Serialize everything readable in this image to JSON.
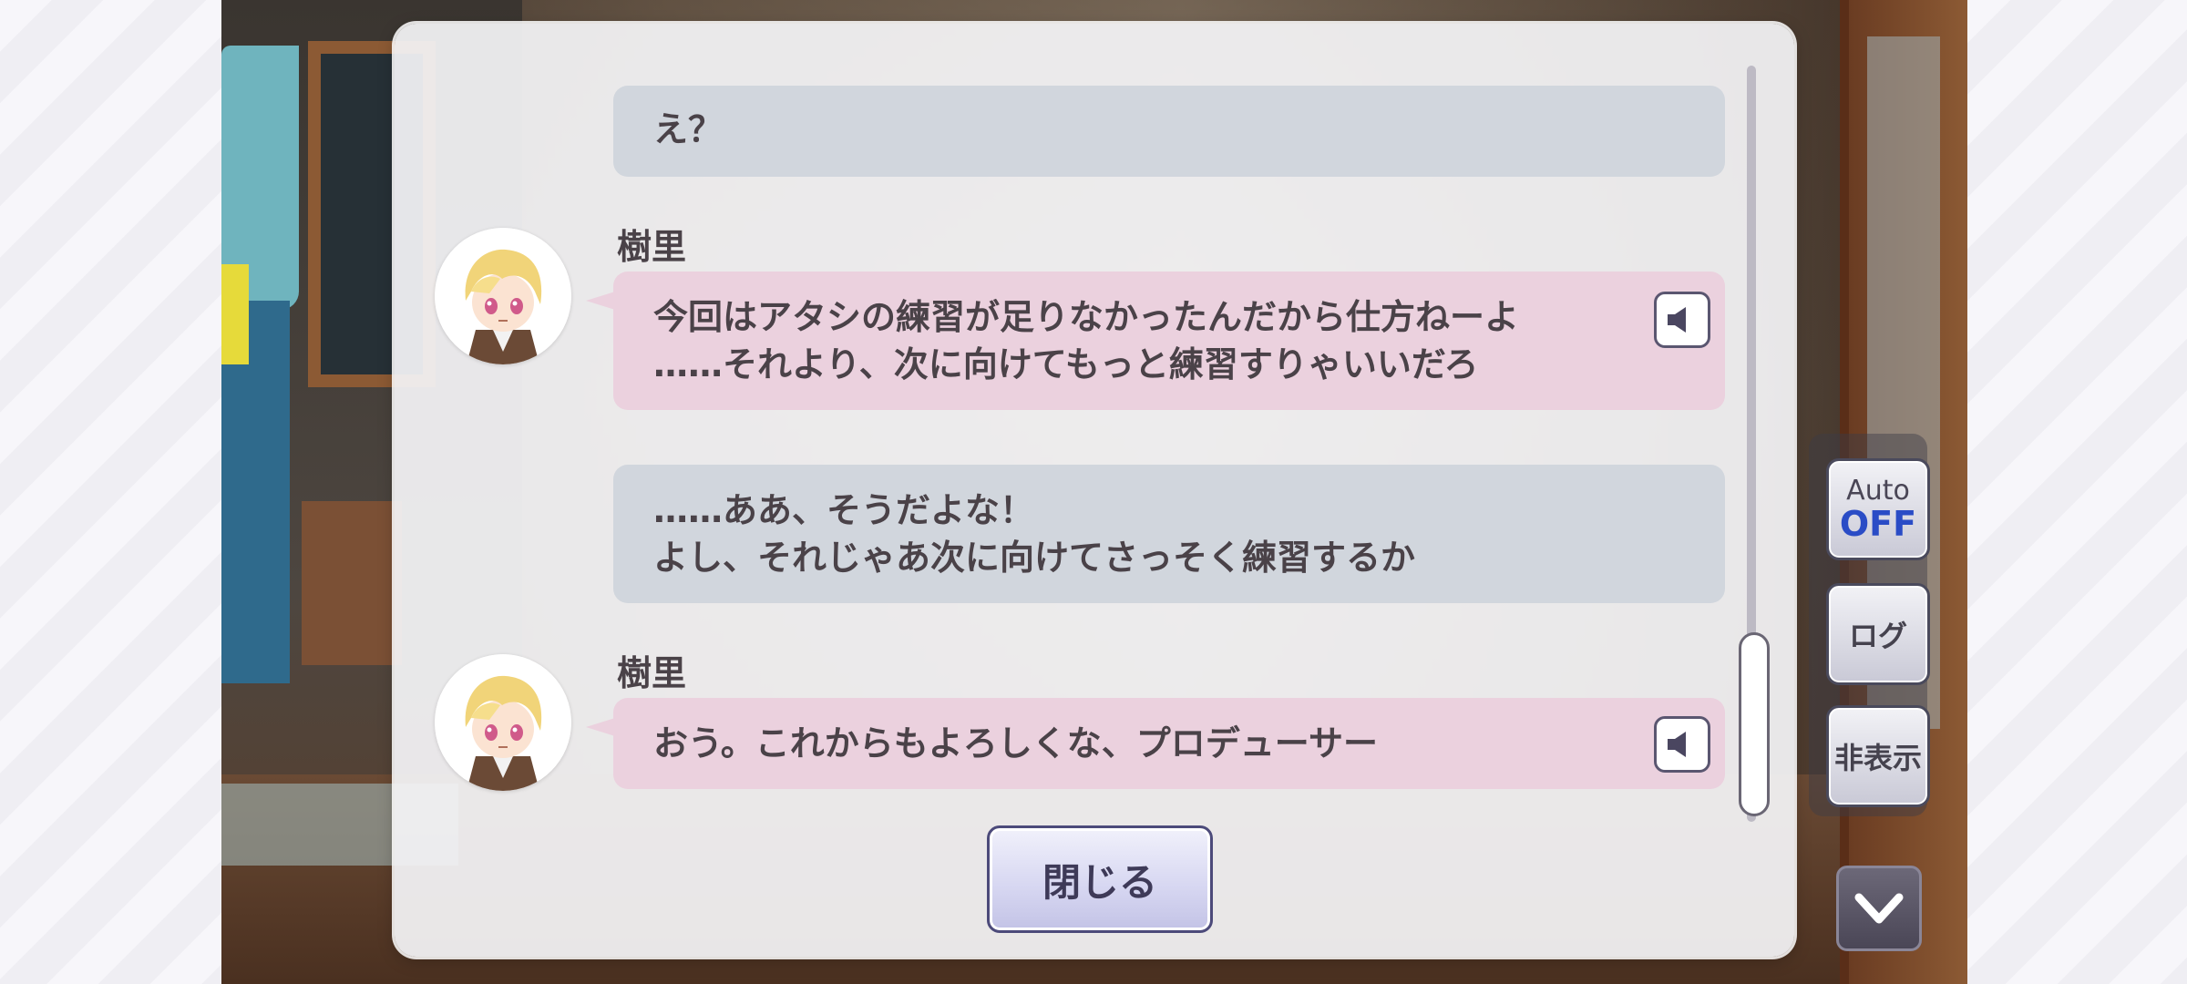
{
  "messages": [
    {
      "type": "protagonist",
      "lines": [
        "え？"
      ]
    },
    {
      "type": "character",
      "speaker": "樹里",
      "lines": [
        "今回はアタシの練習が足りなかったんだから仕方ねーよ",
        "……それより、次に向けてもっと練習すりゃいいだろ"
      ],
      "voice_icon": "speaker-icon"
    },
    {
      "type": "protagonist",
      "lines": [
        "……ああ、そうだよな！",
        "よし、それじゃあ次に向けてさっそく練習するか"
      ]
    },
    {
      "type": "character",
      "speaker": "樹里",
      "lines": [
        "おう。これからもよろしくな、プロデューサー"
      ],
      "voice_icon": "speaker-icon"
    }
  ],
  "dialog": {
    "close_label": "閉じる"
  },
  "side_controls": {
    "auto_label": "Auto",
    "auto_state": "OFF",
    "log_label": "ログ",
    "hide_label": "非表示",
    "down_icon": "chevron-down-icon"
  },
  "colors": {
    "protagonist_bubble": "#d1d6dd",
    "character_bubble": "#ebd1de",
    "text": "#4a4248",
    "auto_off": "#2a4cc6"
  }
}
